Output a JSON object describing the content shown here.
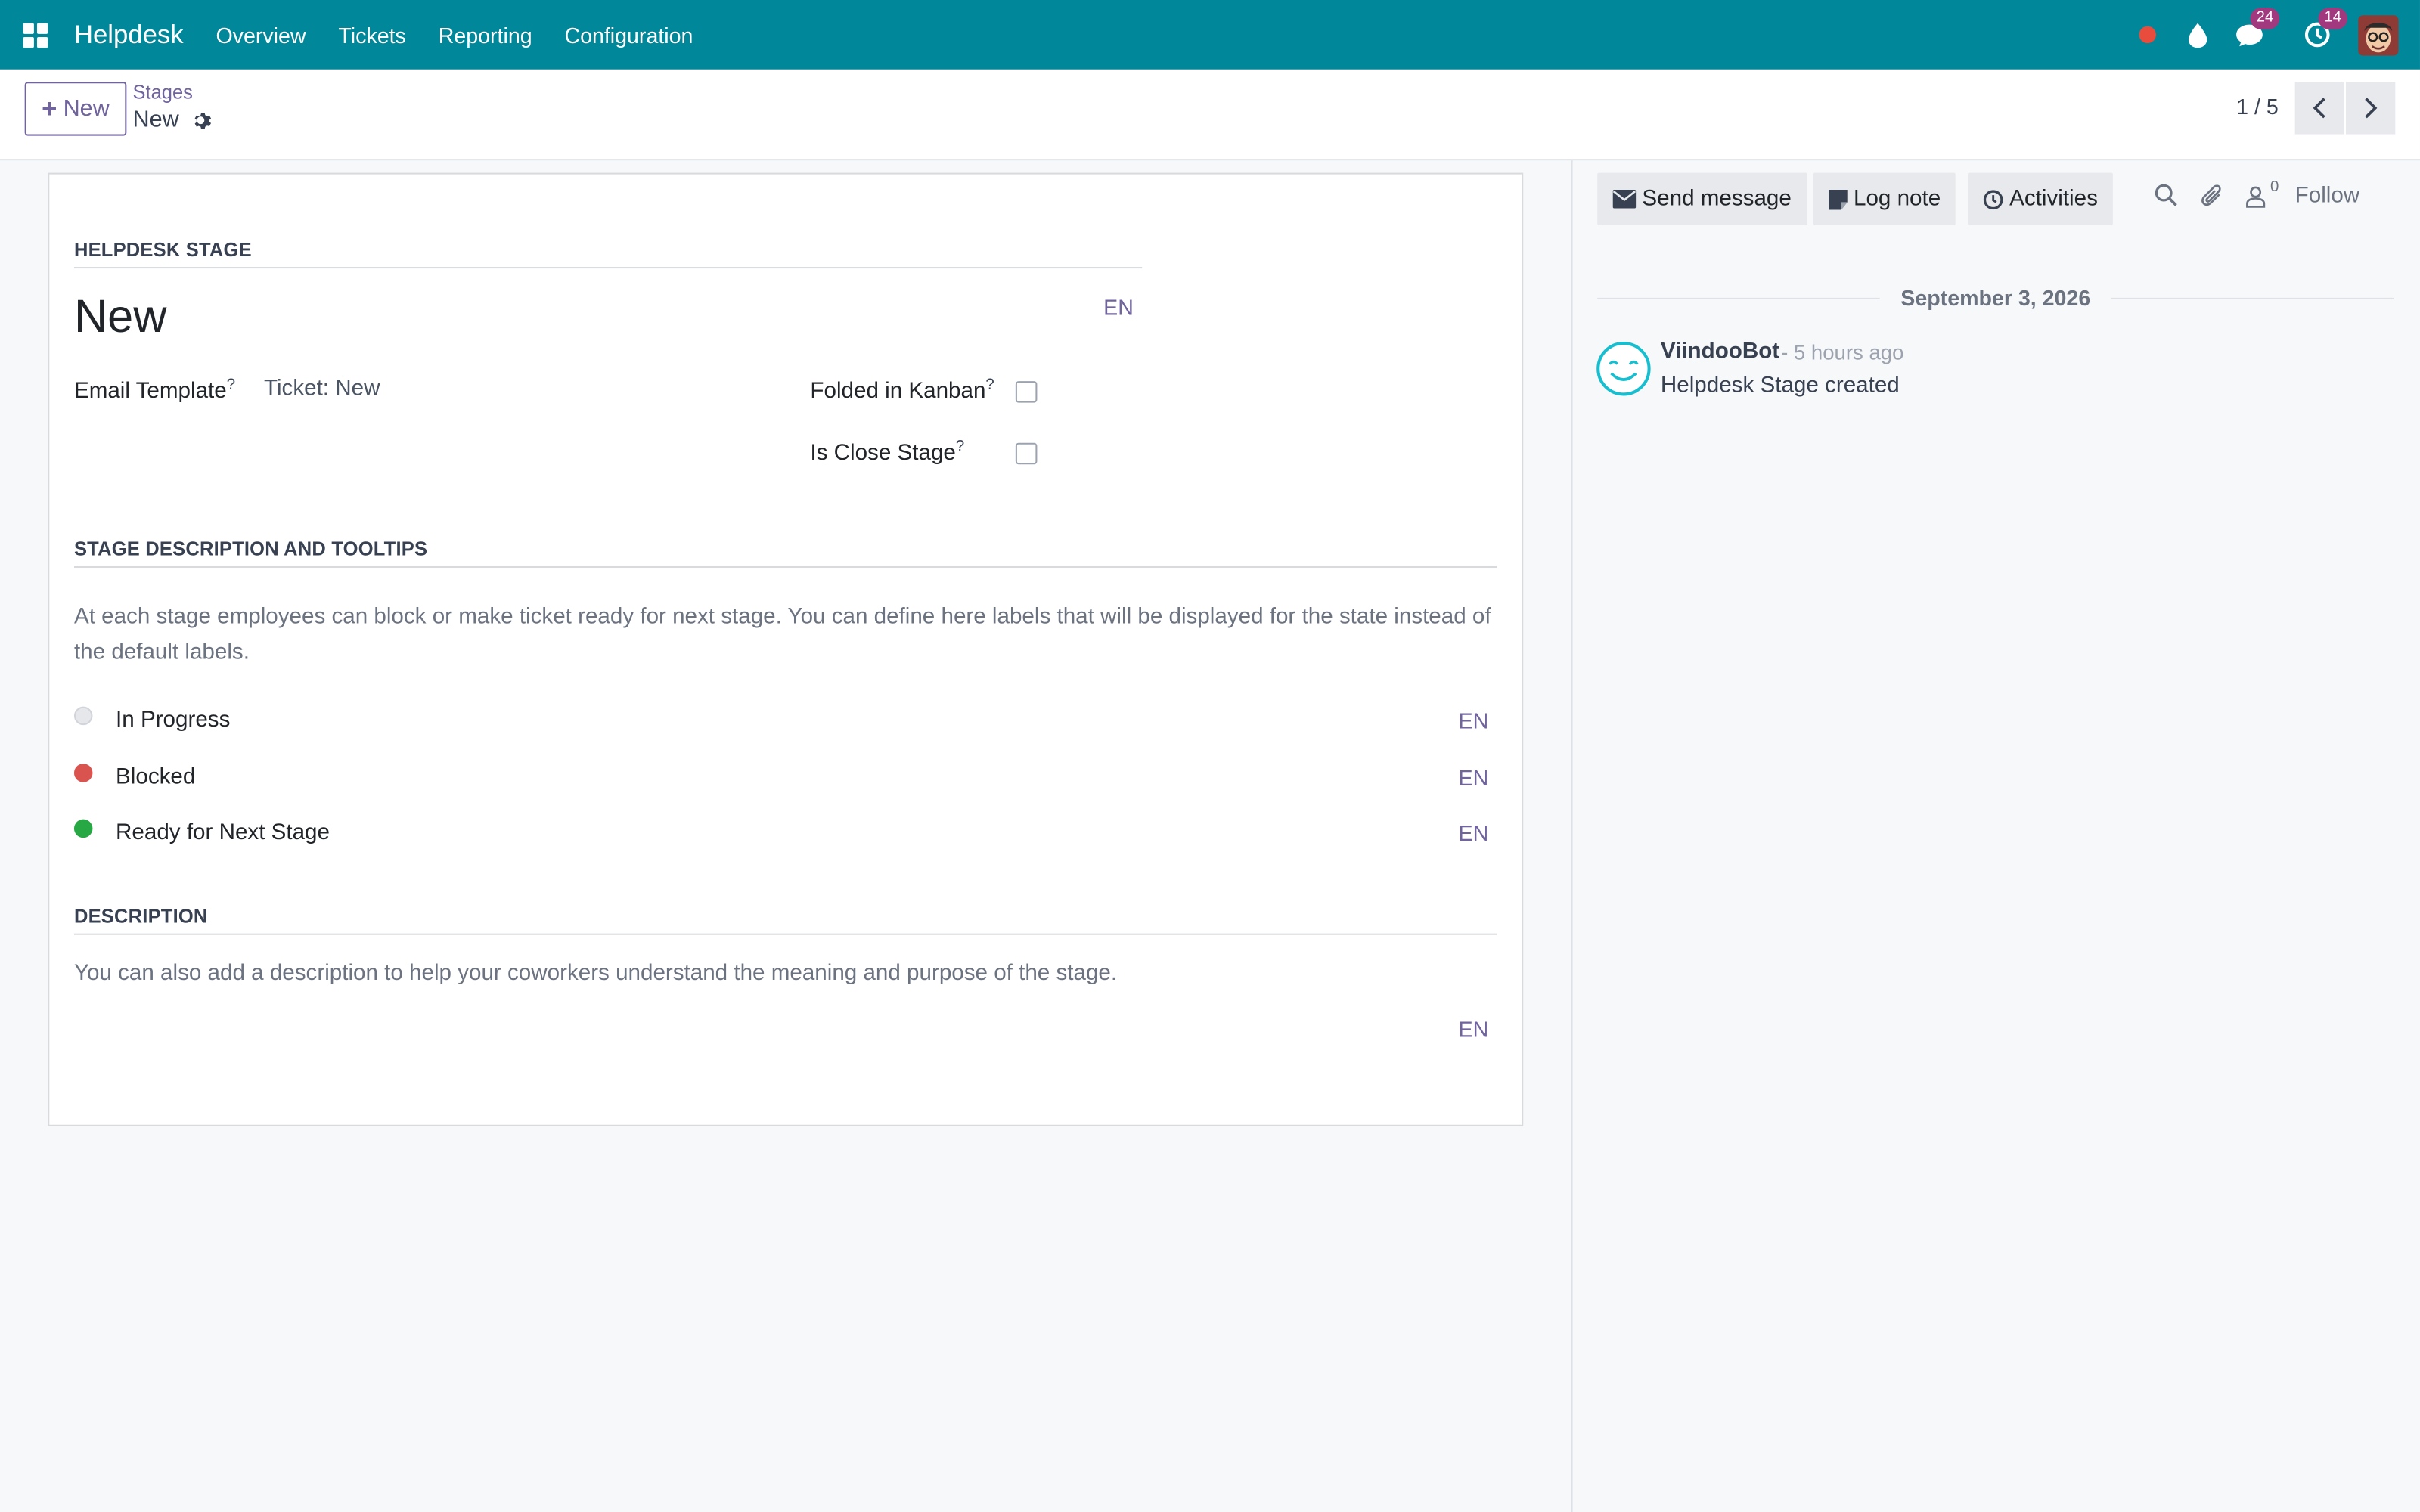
{
  "navbar": {
    "app_name": "Helpdesk",
    "menu": [
      "Overview",
      "Tickets",
      "Reporting",
      "Configuration"
    ],
    "messages_count": "24",
    "activities_count": "14",
    "icons": [
      "apps-grid-icon",
      "status-dot-icon",
      "droplet-icon",
      "chat-icon",
      "clock-icon",
      "user-avatar"
    ],
    "colors": {
      "bar": "#00889a",
      "badge": "#a2387d"
    }
  },
  "control_panel": {
    "new_label": "New",
    "breadcrumb_parent": "Stages",
    "breadcrumb_current": "New",
    "pager_value": "1 / 5"
  },
  "form": {
    "section_stage": "HELPDESK STAGE",
    "stage_name": "New",
    "lang_code": "EN",
    "email_template_label": "Email Template",
    "email_template_value": "Ticket: New",
    "folded_label": "Folded in Kanban",
    "folded_checked": false,
    "close_stage_label": "Is Close Stage",
    "close_stage_checked": false,
    "help_mark": "?",
    "section_tooltips": "STAGE DESCRIPTION AND TOOLTIPS",
    "tooltips_help": "At each stage employees can block or make ticket ready for next stage. You can define here labels that will be displayed for the state instead of the default labels.",
    "states": [
      {
        "label": "In Progress",
        "lang": "EN",
        "color": "#e5e7eb"
      },
      {
        "label": "Blocked",
        "lang": "EN",
        "color": "#d9534f"
      },
      {
        "label": "Ready for Next Stage",
        "lang": "EN",
        "color": "#28a745"
      }
    ],
    "section_description": "DESCRIPTION",
    "description_help": "You can also add a description to help your coworkers understand the meaning and purpose of the stage.",
    "description_lang": "EN"
  },
  "chatter": {
    "send_message": "Send message",
    "log_note": "Log note",
    "activities": "Activities",
    "followers_count": "0",
    "follow": "Follow",
    "date": "September 3, 2026",
    "message": {
      "author": "ViindooBot",
      "time": "- 5 hours ago",
      "body": "Helpdesk Stage created"
    }
  }
}
